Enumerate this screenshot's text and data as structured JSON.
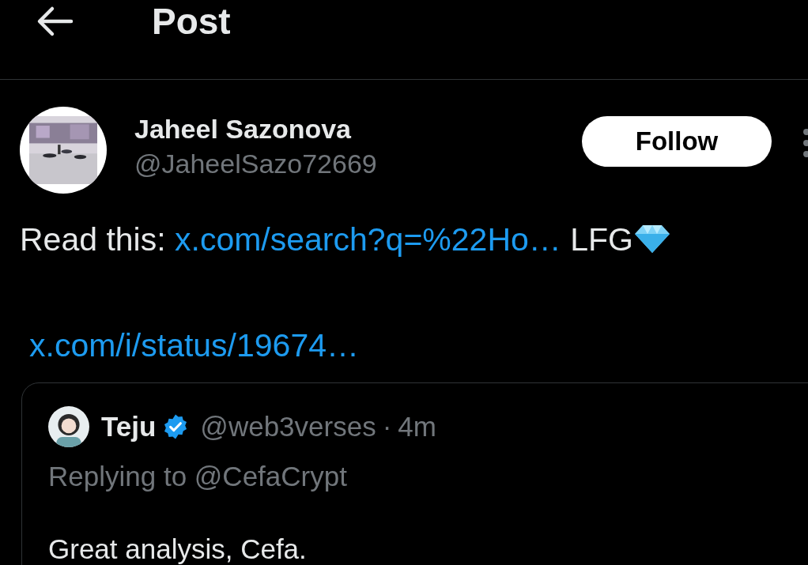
{
  "header": {
    "title": "Post"
  },
  "post": {
    "author": {
      "name": "Jaheel Sazonova",
      "handle": "@JaheelSazo72669"
    },
    "follow_button": "Follow",
    "text_prefix": "Read this: ",
    "link": "x.com/search?q=%22Ho…",
    "text_suffix": " LFG",
    "second_link": "x.com/i/status/19674…",
    "quoted": {
      "name": "Teju",
      "verified": true,
      "handle": "@web3verses",
      "separator": "·",
      "time": "4m",
      "replying_to": "Replying to @CefaCrypt",
      "text": "Great analysis, Cefa."
    }
  }
}
